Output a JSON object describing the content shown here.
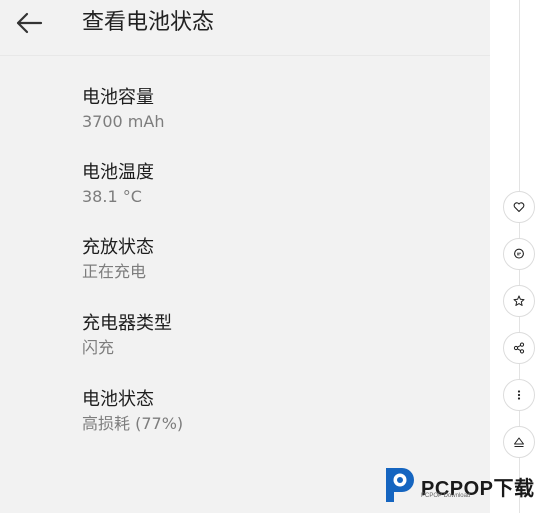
{
  "header": {
    "title": "查看电池状态",
    "back_icon": "arrow-left-icon"
  },
  "items": [
    {
      "label": "电池容量",
      "value": "3700 mAh"
    },
    {
      "label": "电池温度",
      "value": "38.1 °C"
    },
    {
      "label": "充放状态",
      "value": "正在充电"
    },
    {
      "label": "充电器类型",
      "value": "闪充"
    },
    {
      "label": "电池状态",
      "value": "高损耗 (77%)"
    }
  ],
  "side_actions": [
    {
      "icon": "heart-icon"
    },
    {
      "icon": "comment-icon"
    },
    {
      "icon": "star-icon"
    },
    {
      "icon": "share-icon"
    },
    {
      "icon": "more-icon"
    },
    {
      "icon": "scroll-top-icon"
    }
  ],
  "watermark": {
    "brand": "PCPOP下载",
    "subtitle": "PCPOP Download",
    "brand_color": "#1565c0"
  }
}
